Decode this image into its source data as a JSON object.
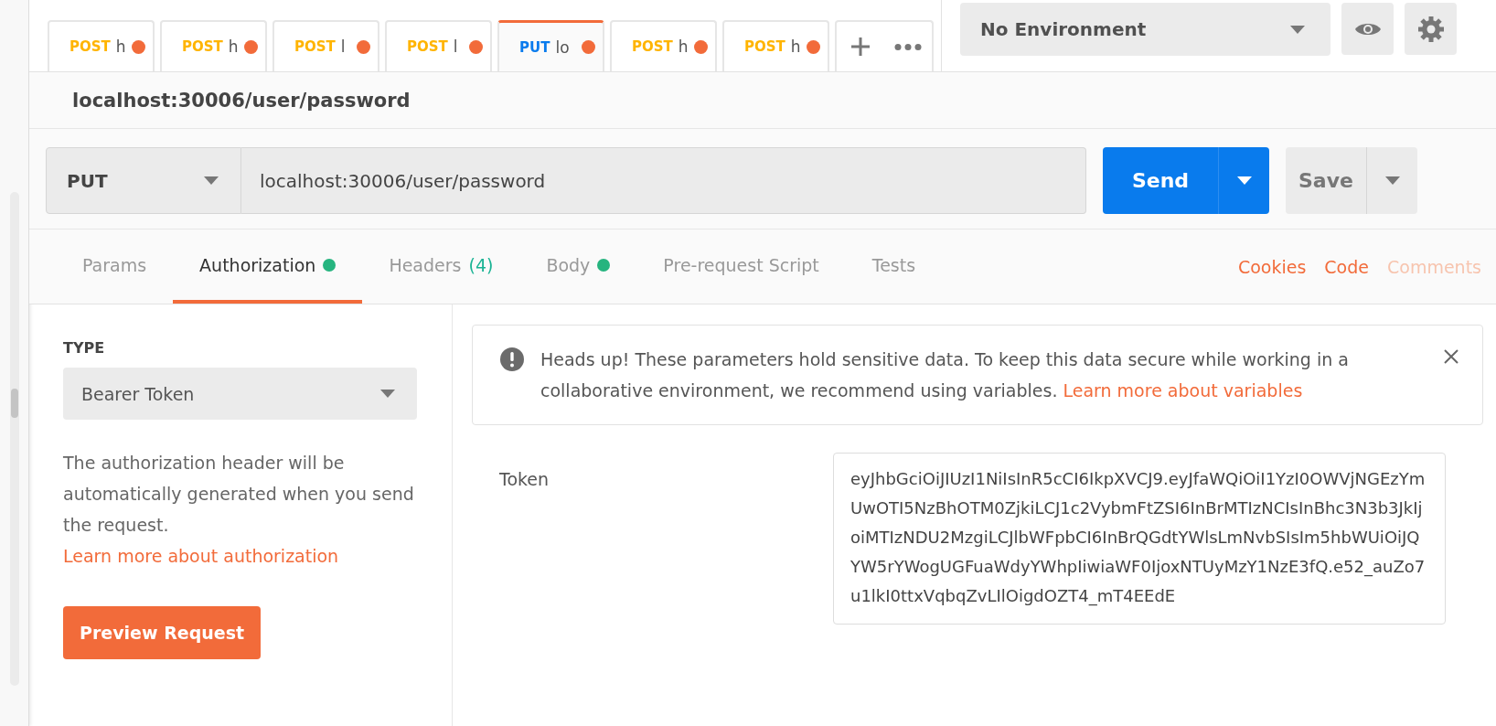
{
  "tabs": [
    {
      "method": "POST",
      "kind": "post",
      "label": "h",
      "selected": false,
      "unsaved": true
    },
    {
      "method": "POST",
      "kind": "post",
      "label": "h",
      "selected": false,
      "unsaved": true
    },
    {
      "method": "POST",
      "kind": "post",
      "label": "l",
      "selected": false,
      "unsaved": true
    },
    {
      "method": "POST",
      "kind": "post",
      "label": "l",
      "selected": false,
      "unsaved": true
    },
    {
      "method": "PUT",
      "kind": "put",
      "label": "lo",
      "selected": true,
      "unsaved": true
    },
    {
      "method": "POST",
      "kind": "post",
      "label": "h",
      "selected": false,
      "unsaved": true
    },
    {
      "method": "POST",
      "kind": "post",
      "label": "h",
      "selected": false,
      "unsaved": true
    }
  ],
  "environment": {
    "value": "No Environment"
  },
  "request_title": "localhost:30006/user/password",
  "request": {
    "method": "PUT",
    "url": "localhost:30006/user/password",
    "send": "Send",
    "save": "Save"
  },
  "request_tabs": [
    {
      "label": "Params",
      "dot": false,
      "selected": false
    },
    {
      "label": "Authorization",
      "dot": true,
      "selected": true
    },
    {
      "label": "Headers",
      "count": "(4)",
      "dot": false,
      "selected": false
    },
    {
      "label": "Body",
      "dot": true,
      "selected": false
    },
    {
      "label": "Pre-request Script",
      "dot": false,
      "selected": false
    },
    {
      "label": "Tests",
      "dot": false,
      "selected": false
    }
  ],
  "links": [
    {
      "label": "Cookies",
      "disabled": false
    },
    {
      "label": "Code",
      "disabled": false
    },
    {
      "label": "Comments",
      "disabled": true
    }
  ],
  "auth": {
    "type_label": "TYPE",
    "type": "Bearer Token",
    "description": "The authorization header will be automatically generated when you send the request.",
    "learn_link": "Learn more about authorization",
    "preview": "Preview Request"
  },
  "alert": {
    "text": "Heads up! These parameters hold sensitive data. To keep this data secure while working in a collaborative environment, we recommend using variables.",
    "link": "Learn more about variables"
  },
  "token": {
    "label": "Token",
    "value": "eyJhbGciOiJIUzI1NiIsInR5cCI6IkpXVCJ9.eyJfaWQiOiI1YzI0OWVjNGEzYmUwOTI5NzBhOTM0ZjkiLCJ1c2VybmFtZSI6InBrMTIzNCIsInBhc3N3b3JkIjoiMTIzNDU2MzgiLCJlbWFpbCI6InBrQGdtYWlsLmNvbSIsIm5hbWUiOiJQYW5rYWogUGFuaWdyYWhpIiwiaWF0IjoxNTUyMzY1NzE3fQ.e52_auZo7u1lkI0ttxVqbqZvLIlOigdOZT4_mT4EEdE"
  }
}
